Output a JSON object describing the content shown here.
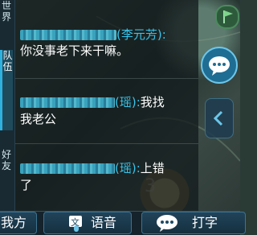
{
  "sidebar": {
    "tabs": [
      {
        "label": "世界"
      },
      {
        "label": "队伍"
      },
      {
        "label": "好友"
      }
    ]
  },
  "messages": [
    {
      "sender": "(李元芳):",
      "text": "你没事老下来干嘛。"
    },
    {
      "sender": "(瑶):",
      "inline_text": "我找",
      "text": "我老公"
    },
    {
      "sender": "(瑶):",
      "inline_text": "上错",
      "text": "了"
    }
  ],
  "bottom_bar": {
    "our_side_label": "我方",
    "voice_label": "语音",
    "type_label": "打字"
  },
  "colors": {
    "sender_name": "#38c3ea",
    "message_text": "#ffffff",
    "accent": "#2fb1e0"
  },
  "icons": [
    "flag-icon",
    "chat-bubble-icon",
    "chevron-left-icon",
    "voice-text-icon",
    "speech-bubble-icon"
  ]
}
